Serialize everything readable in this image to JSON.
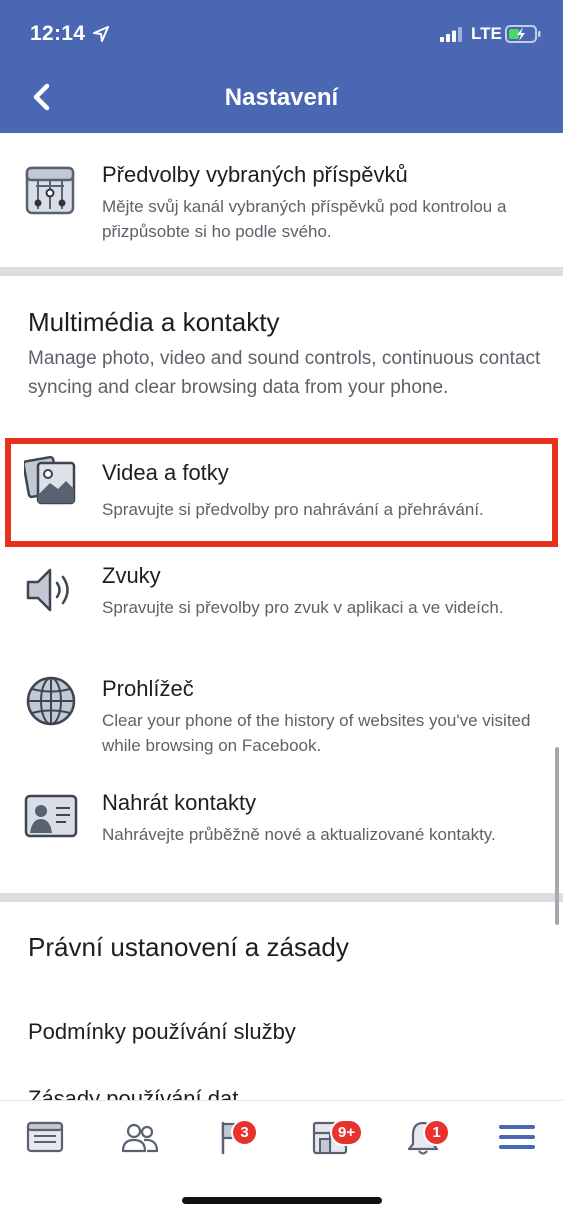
{
  "status_bar": {
    "time": "12:14",
    "network": "LTE",
    "icons": [
      "location-arrow-icon",
      "signal-icon",
      "battery-charging-icon"
    ]
  },
  "nav": {
    "back_icon": "chevron-left-icon",
    "title": "Nastavení"
  },
  "top_item": {
    "icon": "news-feed-preferences-icon",
    "title": "Předvolby vybraných příspěvků",
    "description": "Mějte svůj kanál vybraných příspěvků pod kontrolou a přizpůsobte si ho podle svého."
  },
  "media_section": {
    "heading": "Multimédia a kontakty",
    "description": "Manage photo, video and sound controls, continuous contact syncing and clear browsing data from your phone.",
    "items": [
      {
        "icon": "photos-icon",
        "title": "Videa a fotky",
        "description": "Spravujte si předvolby pro nahrávání a přehrávání.",
        "highlighted": true
      },
      {
        "icon": "speaker-icon",
        "title": "Zvuky",
        "description": "Spravujte si převolby pro zvuk v aplikaci a ve videích."
      },
      {
        "icon": "globe-icon",
        "title": "Prohlížeč",
        "description": "Clear your phone of the history of websites you've visited while browsing on Facebook."
      },
      {
        "icon": "contact-card-icon",
        "title": "Nahrát kontakty",
        "description": "Nahrávejte průběžně nové a aktualizované kontakty."
      }
    ]
  },
  "legal_section": {
    "heading": "Právní ustanovení a zásady",
    "items": [
      "Podmínky používání služby",
      "Zásady používání dat"
    ]
  },
  "highlight_color": "#e8321e",
  "tab_bar": {
    "tabs": [
      {
        "icon": "news-feed-icon",
        "badge": ""
      },
      {
        "icon": "friends-icon",
        "badge": ""
      },
      {
        "icon": "pages-flag-icon",
        "badge": "3"
      },
      {
        "icon": "marketplace-icon",
        "badge": "9+"
      },
      {
        "icon": "notifications-bell-icon",
        "badge": "1"
      },
      {
        "icon": "menu-icon",
        "badge": ""
      }
    ],
    "active_color": "#4a67b3"
  }
}
